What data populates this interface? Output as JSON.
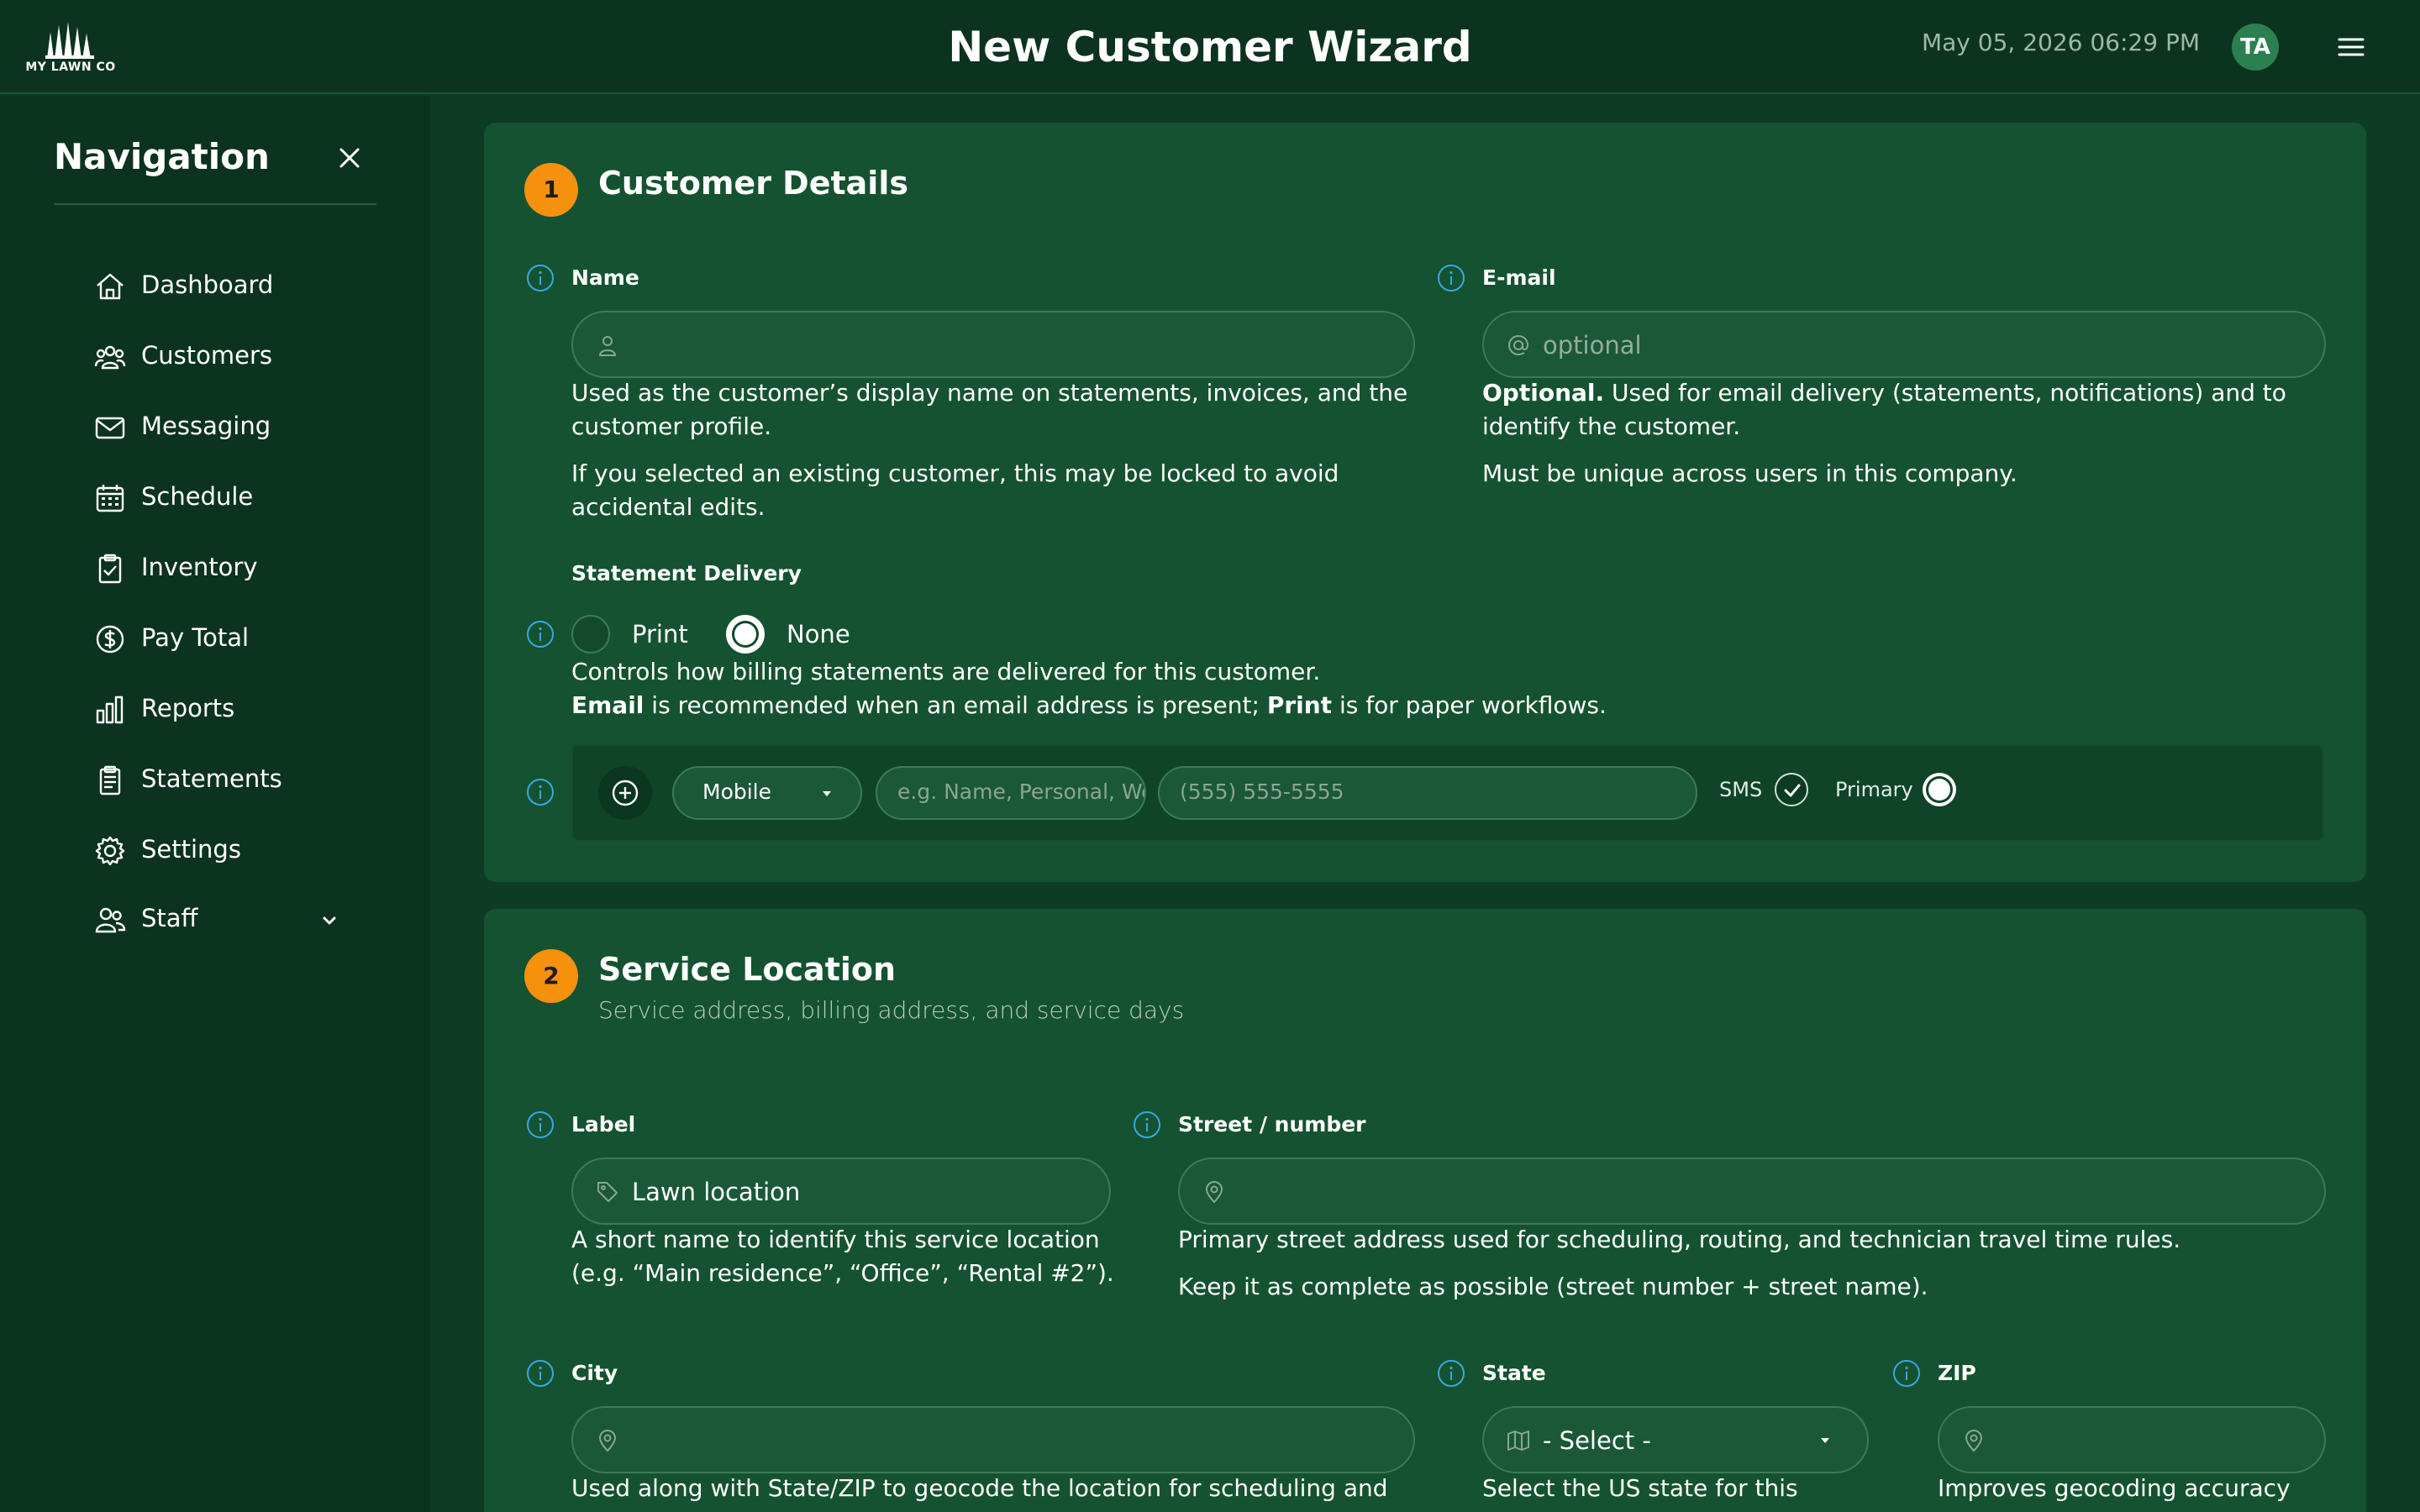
{
  "header": {
    "logo_text": "MY LAWN CO",
    "title": "New Customer Wizard",
    "datetime": "May 05, 2026 06:29 PM",
    "avatar_initials": "TA"
  },
  "sidebar": {
    "title": "Navigation",
    "items": [
      {
        "label": "Dashboard",
        "icon": "home-icon"
      },
      {
        "label": "Customers",
        "icon": "users-icon"
      },
      {
        "label": "Messaging",
        "icon": "envelope-icon"
      },
      {
        "label": "Schedule",
        "icon": "calendar-icon"
      },
      {
        "label": "Inventory",
        "icon": "clipboard-check-icon"
      },
      {
        "label": "Pay Total",
        "icon": "dollar-circle-icon"
      },
      {
        "label": "Reports",
        "icon": "bar-chart-icon"
      },
      {
        "label": "Statements",
        "icon": "receipt-icon"
      },
      {
        "label": "Settings",
        "icon": "gear-icon"
      },
      {
        "label": "Staff",
        "icon": "staff-icon"
      }
    ]
  },
  "customer_details": {
    "step": "1",
    "title": "Customer Details",
    "name": {
      "label": "Name",
      "value": "",
      "help1": "Used as the customer’s display name on statements, invoices, and the customer profile.",
      "help2": "If you selected an existing customer, this may be locked to avoid accidental edits."
    },
    "email": {
      "label": "E-mail",
      "placeholder": "optional",
      "help1_bold": "Optional.",
      "help1_rest": " Used for email delivery (statements, notifications) and to identify the customer.",
      "help2": "Must be unique across users in this company."
    },
    "statement_delivery": {
      "label": "Statement Delivery",
      "options": [
        "Print",
        "None"
      ],
      "selected": "None",
      "help1": "Controls how billing statements are delivered for this customer.",
      "help2_b1": "Email",
      "help2_m": " is recommended when an email address is present; ",
      "help2_b2": "Print",
      "help2_end": " is for paper workflows."
    },
    "phone": {
      "type": "Mobile",
      "label_placeholder": "e.g. Name, Personal, Work",
      "number_placeholder": "(555) 555-5555",
      "sms_label": "SMS",
      "sms_checked": true,
      "primary_label": "Primary",
      "primary_selected": true
    }
  },
  "service_location": {
    "step": "2",
    "title": "Service Location",
    "subtitle": "Service address, billing address, and service days",
    "label_field": {
      "label": "Label",
      "value": "Lawn location",
      "help": "A short name to identify this service location (e.g. “Main residence”, “Office”, “Rental #2”)."
    },
    "street": {
      "label": "Street / number",
      "value": "",
      "help1": "Primary street address used for scheduling, routing, and technician travel time rules.",
      "help2": "Keep it as complete as possible (street number + street name)."
    },
    "city": {
      "label": "City",
      "value": "",
      "help": "Used along with State/ZIP to geocode the location for scheduling and"
    },
    "state": {
      "label": "State",
      "selected": "- Select -",
      "help": "Select the US state for this"
    },
    "zip": {
      "label": "ZIP",
      "value": "",
      "help": "Improves geocoding accuracy"
    }
  },
  "colors": {
    "background": "#0e3b25",
    "card": "#155231",
    "accent_orange": "#f5910d",
    "info_blue": "#38a8e0"
  }
}
